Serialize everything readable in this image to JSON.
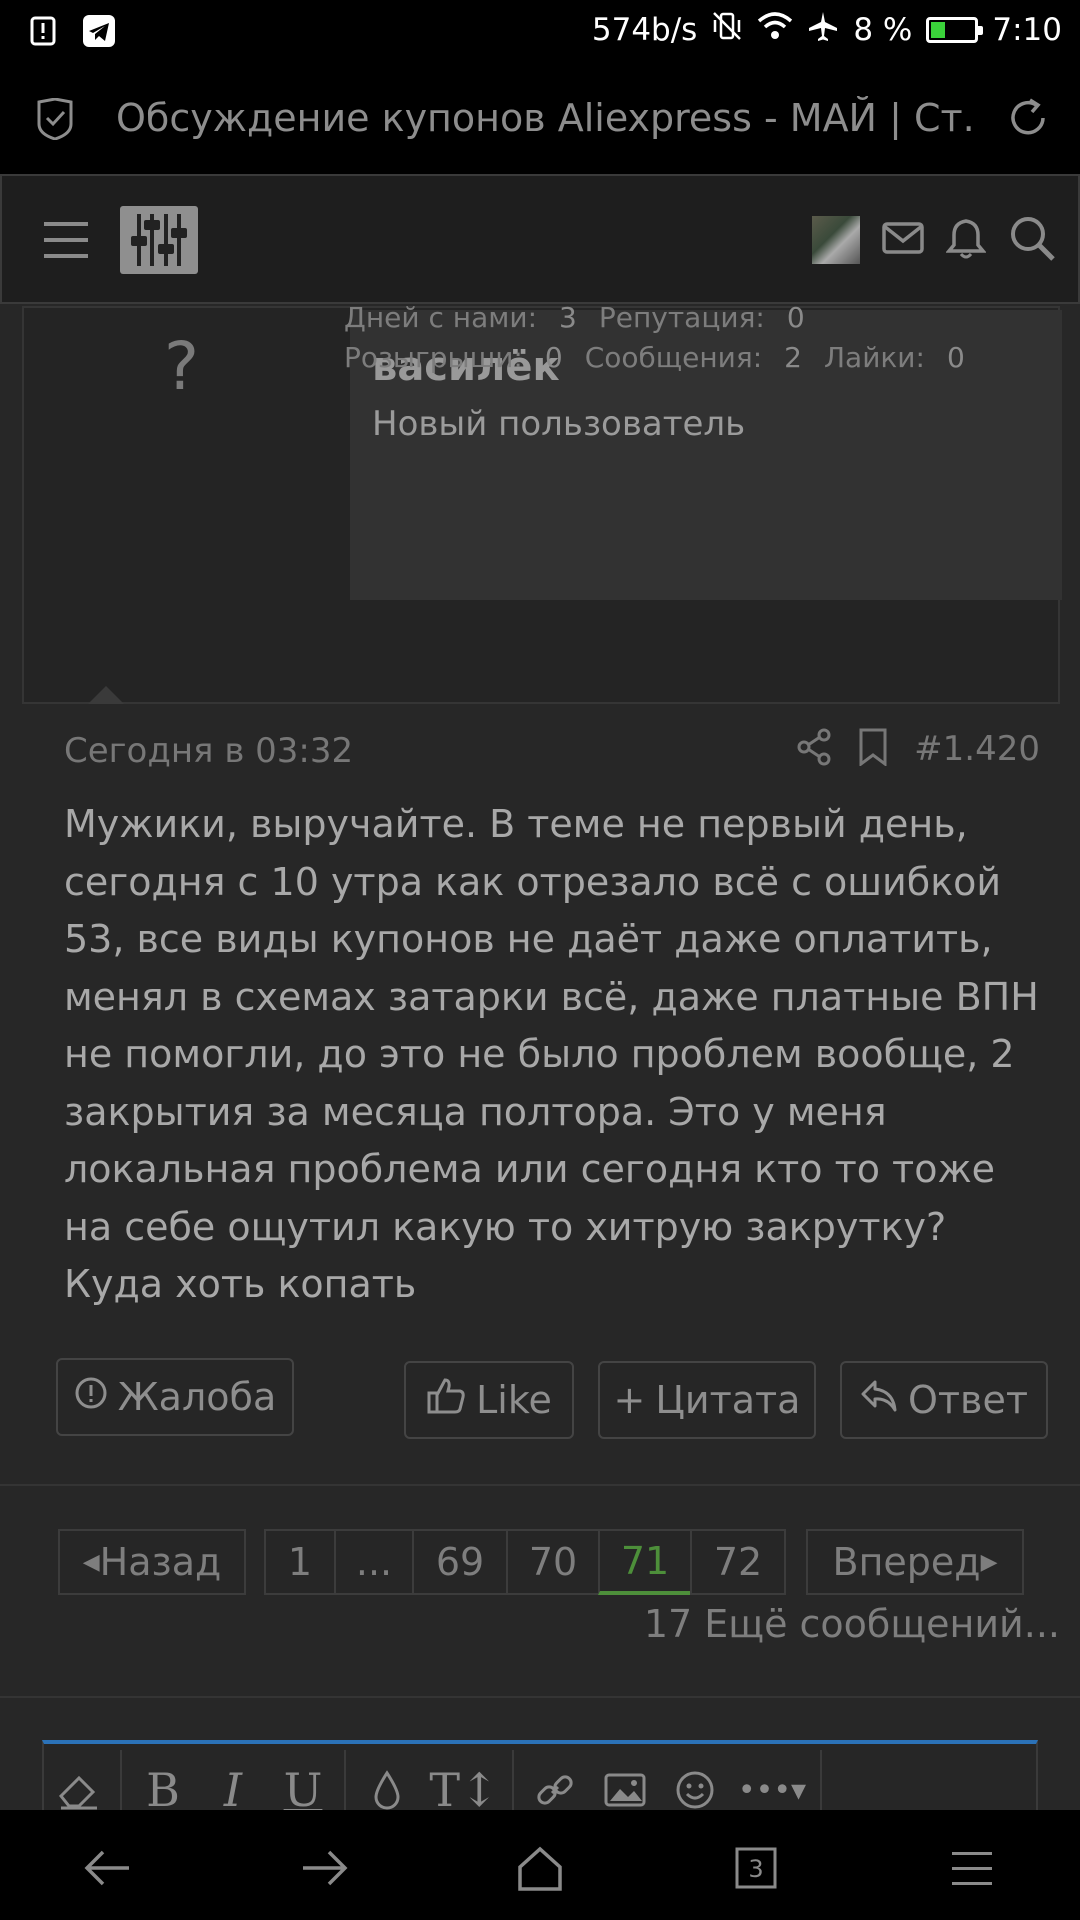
{
  "status_bar": {
    "net_speed": "574b/s",
    "battery_percent": "8 %",
    "battery_level": 0.08,
    "time": "7:10",
    "icons": [
      "alert-icon",
      "telegram-icon",
      "vibrate-off-icon",
      "wifi-icon",
      "airplane-icon",
      "battery-icon"
    ]
  },
  "browser": {
    "page_title": "Обсуждение купонов Aliexpress - МАЙ | Ст..."
  },
  "post": {
    "username": "василёк",
    "user_title": "Новый пользователь",
    "avatar_placeholder": "?",
    "stats": {
      "days_label": "Дней с нами:",
      "days_value": "3",
      "rep_label": "Репутация:",
      "rep_value": "0",
      "giveaways_label": "Розыгрыши:",
      "giveaways_value": "0",
      "messages_label": "Сообщения:",
      "messages_value": "2",
      "likes_label": "Лайки:",
      "likes_value": "0"
    },
    "date": "Сегодня в 03:32",
    "number": "#1.420",
    "body": "Мужики, выручайте. В теме не первый день, сегодня с 10 утра как отрезало всё с ошибкой 53, все виды купонов не даёт даже оплатить, менял в схемах затарки всё, даже платные ВПН не помогли, до это не было проблем вообще, 2 закрытия за месяца полтора. Это у меня локальная проблема или сегодня кто то тоже на себе ощутил какую то хитрую закрутку? Куда хоть копать",
    "actions": {
      "report": "Жалоба",
      "like": "Like",
      "quote": "Цитата",
      "reply": "Ответ"
    }
  },
  "pagination": {
    "prev": "Назад",
    "next": "Вперед",
    "pages": [
      "1",
      "...",
      "69",
      "70",
      "71",
      "72"
    ],
    "current": "71",
    "more": "17 Ещё сообщений..."
  },
  "colors": {
    "accent_green": "#4d8f3a",
    "editor_accent": "#2b72b8",
    "background": "#272727"
  }
}
